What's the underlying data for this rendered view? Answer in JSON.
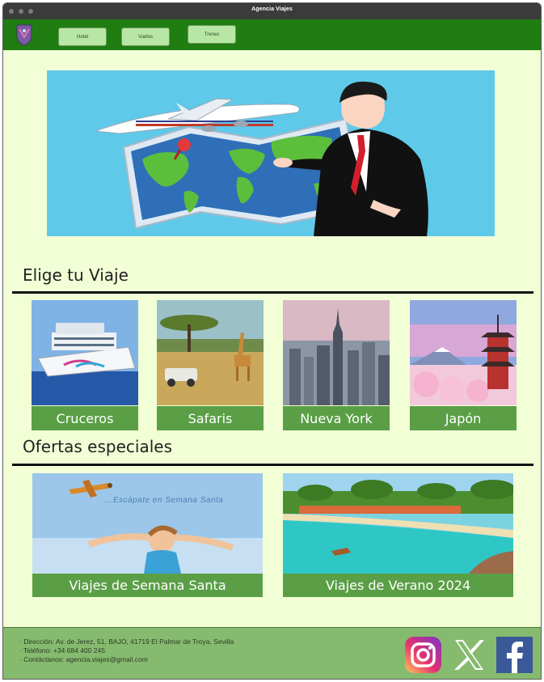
{
  "window": {
    "title": "Agencia Viajes"
  },
  "nav": {
    "items": [
      "Hotel",
      "Vuelos",
      "Trenes"
    ]
  },
  "sections": {
    "choose": "Elige tu Viaje",
    "offers": "Ofertas especiales"
  },
  "destinations": [
    "Cruceros",
    "Safaris",
    "Nueva York",
    "Japón"
  ],
  "offers": [
    "Viajes de Semana Santa",
    "Viajes de Verano 2024"
  ],
  "offer_image_text": {
    "easter": "...Escápate en Semana Santa"
  },
  "footer": {
    "address": "· Dirección: Av. de Jerez, 51, BAJO, 41719 El Palmar de Troya, Sevilla",
    "phone": "· Teléfono: +34 684 400 245",
    "email": "· Contáctanos: agencia.viajes@gmail.com"
  },
  "social": [
    "instagram-icon",
    "x-icon",
    "facebook-icon"
  ],
  "colors": {
    "page_bg": "#f2ffd6",
    "navbar": "#1f7d12",
    "nav_button": "#b8e6a4",
    "label_bg": "#5a9f46",
    "footer_bg": "#86bb6f",
    "hero_bg": "#5fc9e9"
  }
}
